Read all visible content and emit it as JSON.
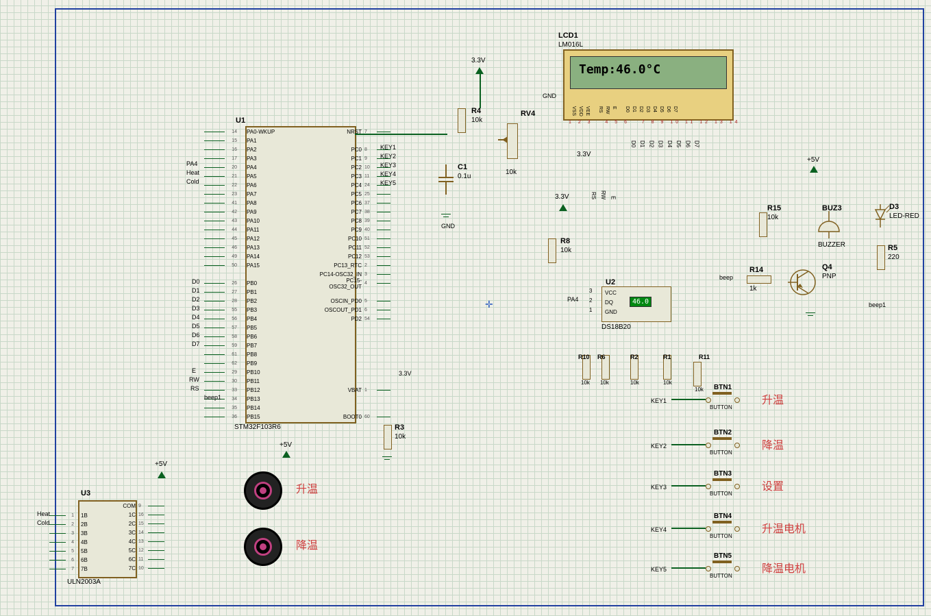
{
  "lcd": {
    "ref": "LCD1",
    "part": "LM016L",
    "text": "Temp:46.0°C",
    "gnd_label": "GND",
    "pins_top": [
      "VSS",
      "VDD",
      "VEE",
      "RS",
      "RW",
      "E",
      "D0",
      "D1",
      "D2",
      "D3",
      "D4",
      "D5",
      "D6",
      "D7"
    ],
    "pin_nums": [
      "1",
      "2",
      "3",
      "4",
      "5",
      "6",
      "7",
      "8",
      "9",
      "10",
      "11",
      "12",
      "13",
      "14"
    ],
    "data_net_labels": [
      "D0",
      "D1",
      "D2",
      "D3",
      "D4",
      "D5",
      "D6",
      "D7"
    ],
    "ctrl_labels": [
      "RS",
      "RW",
      "E"
    ]
  },
  "mcu": {
    "ref": "U1",
    "part": "STM32F103R6",
    "left_pins": [
      {
        "num": "14",
        "name": "PA0-WKUP"
      },
      {
        "num": "15",
        "name": "PA1"
      },
      {
        "num": "16",
        "name": "PA2"
      },
      {
        "num": "17",
        "name": "PA3"
      },
      {
        "num": "20",
        "name": "PA4"
      },
      {
        "num": "21",
        "name": "PA5"
      },
      {
        "num": "22",
        "name": "PA6"
      },
      {
        "num": "23",
        "name": "PA7"
      },
      {
        "num": "41",
        "name": "PA8"
      },
      {
        "num": "42",
        "name": "PA9"
      },
      {
        "num": "43",
        "name": "PA10"
      },
      {
        "num": "44",
        "name": "PA11"
      },
      {
        "num": "45",
        "name": "PA12"
      },
      {
        "num": "46",
        "name": "PA13"
      },
      {
        "num": "49",
        "name": "PA14"
      },
      {
        "num": "50",
        "name": "PA15"
      },
      {
        "num": "",
        "name": ""
      },
      {
        "num": "26",
        "name": "PB0"
      },
      {
        "num": "27",
        "name": "PB1"
      },
      {
        "num": "28",
        "name": "PB2"
      },
      {
        "num": "55",
        "name": "PB3"
      },
      {
        "num": "56",
        "name": "PB4"
      },
      {
        "num": "57",
        "name": "PB5"
      },
      {
        "num": "58",
        "name": "PB6"
      },
      {
        "num": "59",
        "name": "PB7"
      },
      {
        "num": "61",
        "name": "PB8"
      },
      {
        "num": "62",
        "name": "PB9"
      },
      {
        "num": "29",
        "name": "PB10"
      },
      {
        "num": "30",
        "name": "PB11"
      },
      {
        "num": "33",
        "name": "PB12"
      },
      {
        "num": "34",
        "name": "PB13"
      },
      {
        "num": "35",
        "name": "PB14"
      },
      {
        "num": "36",
        "name": "PB15"
      }
    ],
    "right_pins": [
      {
        "num": "7",
        "name": "NRST"
      },
      {
        "num": "",
        "name": ""
      },
      {
        "num": "8",
        "name": "PC0"
      },
      {
        "num": "9",
        "name": "PC1"
      },
      {
        "num": "10",
        "name": "PC2"
      },
      {
        "num": "11",
        "name": "PC3"
      },
      {
        "num": "24",
        "name": "PC4"
      },
      {
        "num": "25",
        "name": "PC5"
      },
      {
        "num": "37",
        "name": "PC6"
      },
      {
        "num": "38",
        "name": "PC7"
      },
      {
        "num": "39",
        "name": "PC8"
      },
      {
        "num": "40",
        "name": "PC9"
      },
      {
        "num": "51",
        "name": "PC10"
      },
      {
        "num": "52",
        "name": "PC11"
      },
      {
        "num": "53",
        "name": "PC12"
      },
      {
        "num": "2",
        "name": "PC13_RTC"
      },
      {
        "num": "3",
        "name": "PC14-OSC32_IN"
      },
      {
        "num": "4",
        "name": "PC15-OSC32_OUT"
      },
      {
        "num": "",
        "name": ""
      },
      {
        "num": "5",
        "name": "OSCIN_PD0"
      },
      {
        "num": "6",
        "name": "OSCOUT_PD1"
      },
      {
        "num": "54",
        "name": "PD2"
      },
      {
        "num": "",
        "name": ""
      },
      {
        "num": "",
        "name": ""
      },
      {
        "num": "",
        "name": ""
      },
      {
        "num": "",
        "name": ""
      },
      {
        "num": "",
        "name": ""
      },
      {
        "num": "",
        "name": ""
      },
      {
        "num": "",
        "name": ""
      },
      {
        "num": "1",
        "name": "VBAT"
      },
      {
        "num": "",
        "name": ""
      },
      {
        "num": "",
        "name": ""
      },
      {
        "num": "60",
        "name": "BOOT0"
      }
    ],
    "left_nets": {
      "PA4": "PA4",
      "Heat": "Heat",
      "Cold": "Cold",
      "D0": "D0",
      "D1": "D1",
      "D2": "D2",
      "D3": "D3",
      "D4": "D4",
      "D5": "D5",
      "D6": "D6",
      "D7": "D7",
      "E": "E",
      "RW": "RW",
      "RS": "RS",
      "beep1": "beep1"
    },
    "right_nets": {
      "KEY1": "KEY1",
      "KEY2": "KEY2",
      "KEY3": "KEY3",
      "KEY4": "KEY4",
      "KEY5": "KEY5"
    }
  },
  "uln": {
    "ref": "U3",
    "part": "ULN2003A",
    "left_pins": [
      {
        "num": "1",
        "name": "1B"
      },
      {
        "num": "2",
        "name": "2B"
      },
      {
        "num": "3",
        "name": "3B"
      },
      {
        "num": "4",
        "name": "4B"
      },
      {
        "num": "5",
        "name": "5B"
      },
      {
        "num": "6",
        "name": "6B"
      },
      {
        "num": "7",
        "name": "7B"
      }
    ],
    "right_pins": [
      {
        "num": "9",
        "name": "COM"
      },
      {
        "num": "16",
        "name": "1C"
      },
      {
        "num": "15",
        "name": "2C"
      },
      {
        "num": "14",
        "name": "3C"
      },
      {
        "num": "13",
        "name": "4C"
      },
      {
        "num": "12",
        "name": "5C"
      },
      {
        "num": "11",
        "name": "6C"
      },
      {
        "num": "10",
        "name": "7C"
      }
    ],
    "left_nets": {
      "Heat": "Heat",
      "Cold": "Cold"
    }
  },
  "sensor": {
    "ref": "U2",
    "part": "DS18B20",
    "pins": [
      "VCC",
      "DQ",
      "GND"
    ],
    "pin_nums": [
      "3",
      "2",
      "1"
    ],
    "value": "46.0",
    "net": "PA4"
  },
  "components": {
    "R4": {
      "ref": "R4",
      "val": "10k"
    },
    "RV4": {
      "ref": "RV4",
      "val": "10k"
    },
    "C1": {
      "ref": "C1",
      "val": "0.1u"
    },
    "R8": {
      "ref": "R8",
      "val": "10k"
    },
    "R3": {
      "ref": "R3",
      "val": "10k"
    },
    "R10": {
      "ref": "R10",
      "val": "10k"
    },
    "R6": {
      "ref": "R6",
      "val": "10k"
    },
    "R2": {
      "ref": "R2",
      "val": "10k"
    },
    "R1": {
      "ref": "R1",
      "val": "10k"
    },
    "R11": {
      "ref": "R11",
      "val": "10k"
    },
    "R15": {
      "ref": "R15",
      "val": "10k"
    },
    "R14": {
      "ref": "R14",
      "val": "1k"
    },
    "R5": {
      "ref": "R5",
      "val": "220"
    },
    "BUZ3": {
      "ref": "BUZ3",
      "val": "BUZZER"
    },
    "D3": {
      "ref": "D3",
      "val": "LED-RED"
    },
    "Q4": {
      "ref": "Q4",
      "val": "PNP"
    }
  },
  "buttons": {
    "BTN1": {
      "ref": "BTN1",
      "part": "BUTTON",
      "label": "升温",
      "net": "KEY1"
    },
    "BTN2": {
      "ref": "BTN2",
      "part": "BUTTON",
      "label": "降温",
      "net": "KEY2"
    },
    "BTN3": {
      "ref": "BTN3",
      "part": "BUTTON",
      "label": "设置",
      "net": "KEY3"
    },
    "BTN4": {
      "ref": "BTN4",
      "part": "BUTTON",
      "label": "升温电机",
      "net": "KEY4"
    },
    "BTN5": {
      "ref": "BTN5",
      "part": "BUTTON",
      "label": "降温电机",
      "net": "KEY5"
    }
  },
  "motors": {
    "m1_label": "升温",
    "m2_label": "降温"
  },
  "power": {
    "v33": "3.3V",
    "v5": "+5V",
    "gnd": "GND",
    "beep_net": "beep",
    "beep1_net": "beep1"
  }
}
